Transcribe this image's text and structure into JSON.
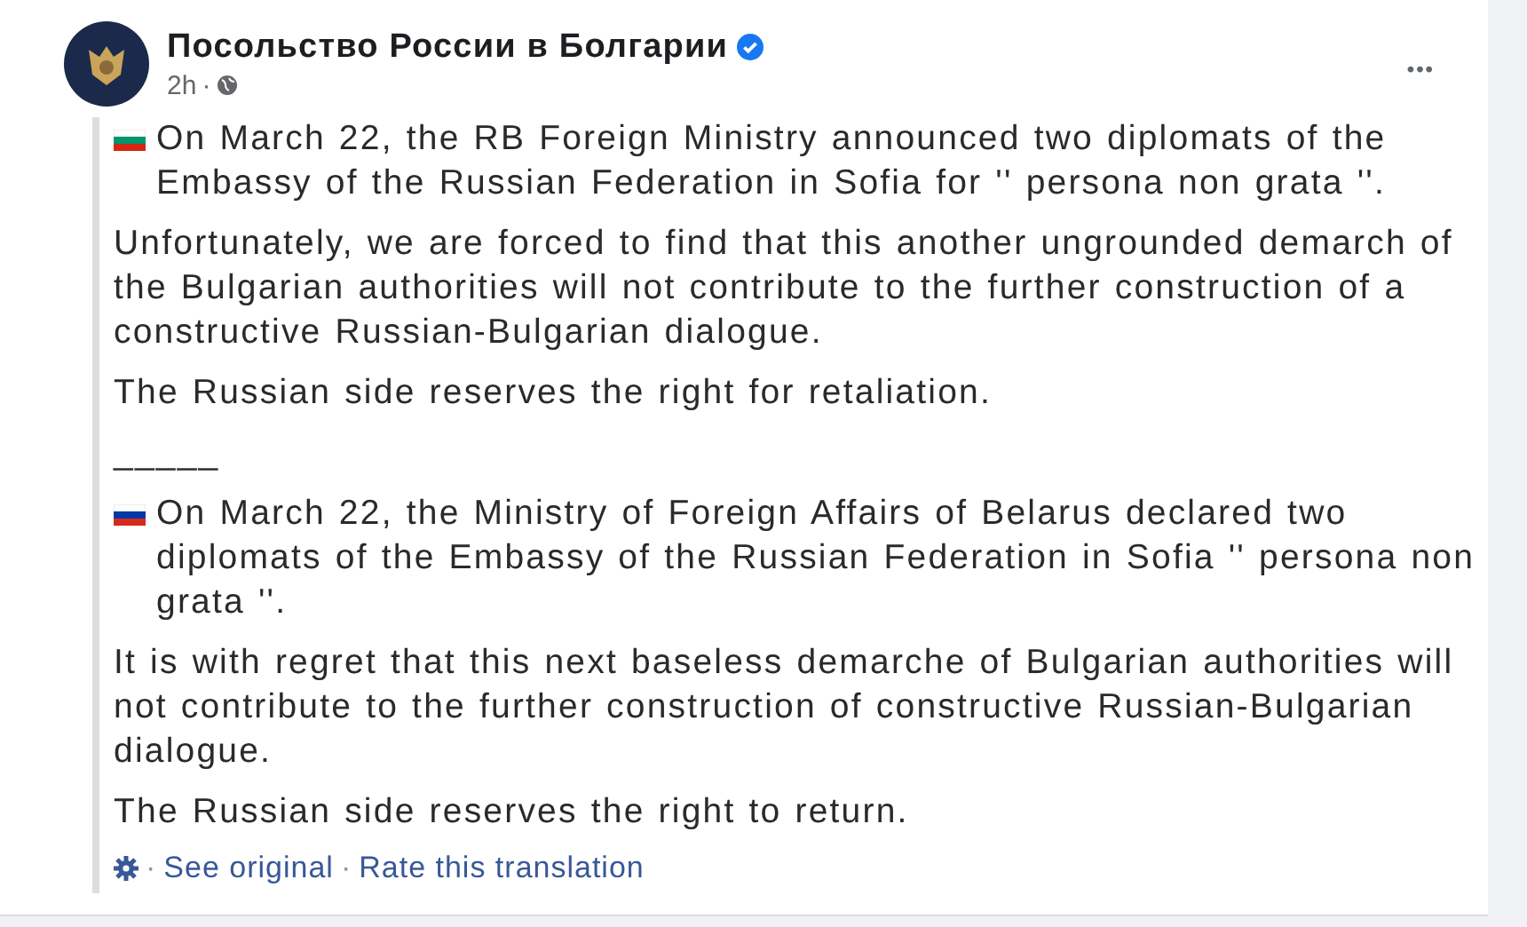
{
  "post": {
    "author": "Посольство России в Болгарии",
    "verified": true,
    "time": "2h",
    "time_separator": "·",
    "menu": "•••",
    "paragraphs": [
      {
        "kind": "bulgarian",
        "text": "On March 22, the RB Foreign Ministry announced two diplomats of the Embassy of the Russian Federation in Sofia for '' persona non grata ''."
      },
      {
        "text": "Unfortunately, we are forced to find that this another ungrounded demarch of the Bulgarian authorities will not contribute to the further construction of a constructive Russian-Bulgarian dialogue."
      },
      {
        "text": "The Russian side reserves the right for retaliation."
      },
      {
        "text": "_____"
      },
      {
        "kind": "russian",
        "text": "On March 22, the Ministry of Foreign Affairs of Belarus declared two diplomats of the Embassy of the Russian Federation in Sofia '' persona non grata ''."
      },
      {
        "text": "It is with regret that this next baseless demarche of Bulgarian authorities will not contribute to the further construction of constructive Russian-Bulgarian dialogue."
      },
      {
        "text": "The Russian side reserves the right to return."
      }
    ],
    "footer": {
      "separator_1": "·",
      "see_original": "See original",
      "separator_2": "·",
      "rate": "Rate this translation"
    }
  }
}
